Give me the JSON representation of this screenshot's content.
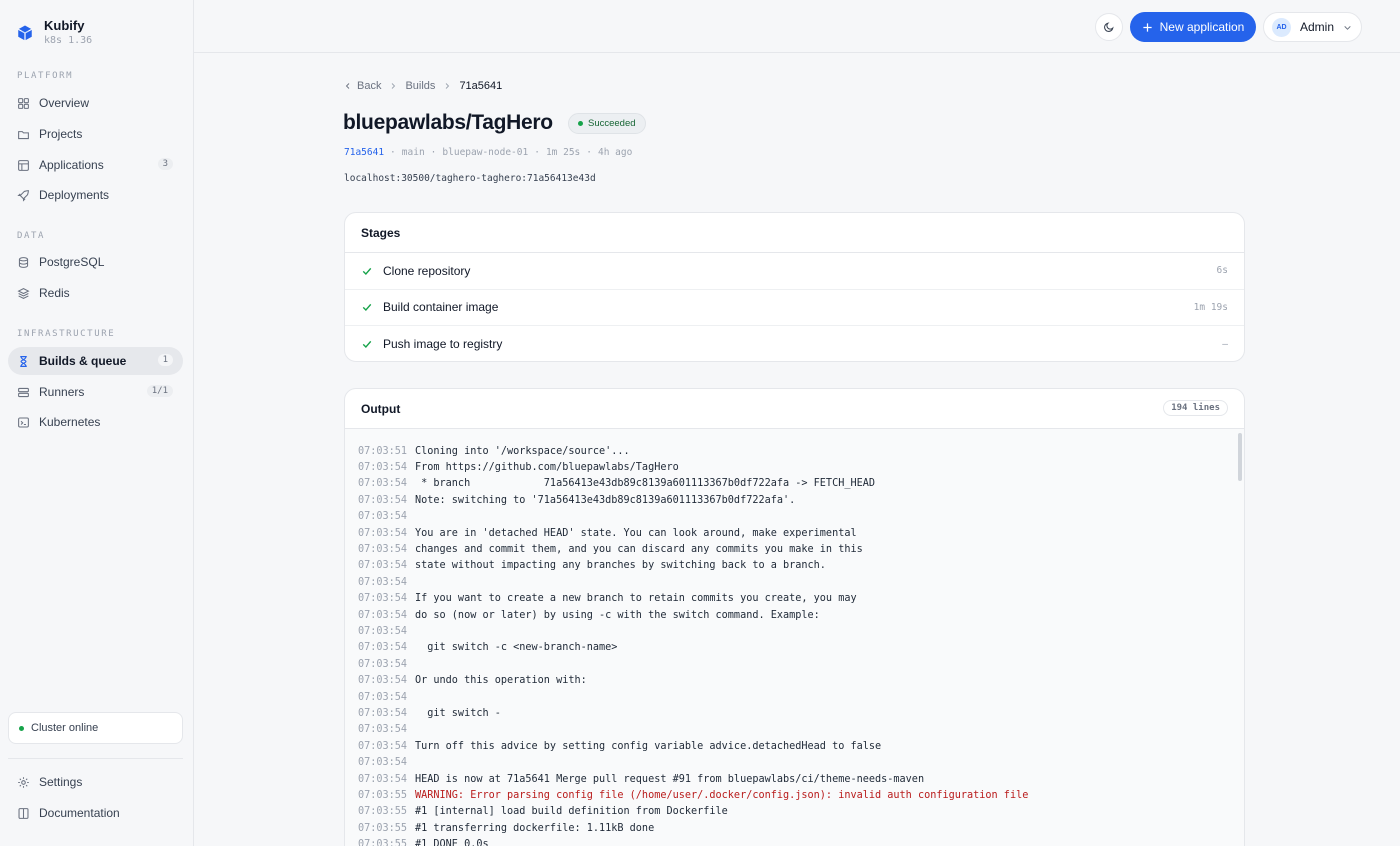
{
  "brand": {
    "name": "Kubify",
    "version": "k8s 1.36"
  },
  "sidebar": {
    "sections": [
      {
        "title": "PLATFORM"
      },
      {
        "title": "DATA"
      },
      {
        "title": "INFRASTRUCTURE"
      }
    ],
    "items": [
      {
        "label": "Overview",
        "icon": "grid-icon"
      },
      {
        "label": "Projects",
        "icon": "folder-icon"
      },
      {
        "label": "Applications",
        "icon": "layout-icon",
        "badge": "3"
      },
      {
        "label": "Deployments",
        "icon": "rocket-icon"
      },
      {
        "label": "PostgreSQL",
        "icon": "database-icon"
      },
      {
        "label": "Redis",
        "icon": "layers-icon"
      },
      {
        "label": "Builds & queue",
        "icon": "hourglass-icon",
        "badge": "1",
        "active": true
      },
      {
        "label": "Runners",
        "icon": "server-icon",
        "badge": "1/1"
      },
      {
        "label": "Kubernetes",
        "icon": "terminal-icon"
      }
    ],
    "cluster_status": "Cluster online",
    "footer": [
      {
        "label": "Settings",
        "icon": "gear-icon"
      },
      {
        "label": "Documentation",
        "icon": "book-icon"
      }
    ]
  },
  "header": {
    "new_app_label": "New application",
    "user_initials": "AD",
    "user_name": "Admin"
  },
  "breadcrumb": {
    "back": "Back",
    "builds": "Builds",
    "current": "71a5641"
  },
  "build": {
    "title": "bluepawlabs/TagHero",
    "status": "Succeeded",
    "sha": "71a5641",
    "branch": "main",
    "node": "bluepaw-node-01",
    "duration": "1m 25s",
    "age": "4h ago",
    "separator": "·",
    "image": "localhost:30500/taghero-taghero:71a56413e43d"
  },
  "stages": {
    "title": "Stages",
    "items": [
      {
        "name": "Clone repository",
        "duration": "6s"
      },
      {
        "name": "Build container image",
        "duration": "1m 19s"
      },
      {
        "name": "Push image to registry",
        "duration": "—"
      }
    ]
  },
  "output": {
    "title": "Output",
    "lines_label": "194 lines",
    "lines": [
      {
        "ts": "07:03:51",
        "msg": "Cloning into '/workspace/source'..."
      },
      {
        "ts": "07:03:54",
        "msg": "From https://github.com/bluepawlabs/TagHero"
      },
      {
        "ts": "07:03:54",
        "msg": " * branch            71a56413e43db89c8139a601113367b0df722afa -> FETCH_HEAD"
      },
      {
        "ts": "07:03:54",
        "msg": "Note: switching to '71a56413e43db89c8139a601113367b0df722afa'."
      },
      {
        "ts": "07:03:54",
        "msg": ""
      },
      {
        "ts": "07:03:54",
        "msg": "You are in 'detached HEAD' state. You can look around, make experimental"
      },
      {
        "ts": "07:03:54",
        "msg": "changes and commit them, and you can discard any commits you make in this"
      },
      {
        "ts": "07:03:54",
        "msg": "state without impacting any branches by switching back to a branch."
      },
      {
        "ts": "07:03:54",
        "msg": ""
      },
      {
        "ts": "07:03:54",
        "msg": "If you want to create a new branch to retain commits you create, you may"
      },
      {
        "ts": "07:03:54",
        "msg": "do so (now or later) by using -c with the switch command. Example:"
      },
      {
        "ts": "07:03:54",
        "msg": ""
      },
      {
        "ts": "07:03:54",
        "msg": "  git switch -c <new-branch-name>"
      },
      {
        "ts": "07:03:54",
        "msg": ""
      },
      {
        "ts": "07:03:54",
        "msg": "Or undo this operation with:"
      },
      {
        "ts": "07:03:54",
        "msg": ""
      },
      {
        "ts": "07:03:54",
        "msg": "  git switch -"
      },
      {
        "ts": "07:03:54",
        "msg": ""
      },
      {
        "ts": "07:03:54",
        "msg": "Turn off this advice by setting config variable advice.detachedHead to false"
      },
      {
        "ts": "07:03:54",
        "msg": ""
      },
      {
        "ts": "07:03:54",
        "msg": "HEAD is now at 71a5641 Merge pull request #91 from bluepawlabs/ci/theme-needs-maven"
      },
      {
        "ts": "07:03:55",
        "msg": "WARNING: Error parsing config file (/home/user/.docker/config.json): invalid auth configuration file",
        "warn": true
      },
      {
        "ts": "07:03:55",
        "msg": "#1 [internal] load build definition from Dockerfile"
      },
      {
        "ts": "07:03:55",
        "msg": "#1 transferring dockerfile: 1.11kB done"
      },
      {
        "ts": "07:03:55",
        "msg": "#1 DONE 0.0s"
      }
    ]
  },
  "colors": {
    "accent": "#2563eb",
    "success": "#16a34a",
    "warning_text": "#b91c1c"
  }
}
